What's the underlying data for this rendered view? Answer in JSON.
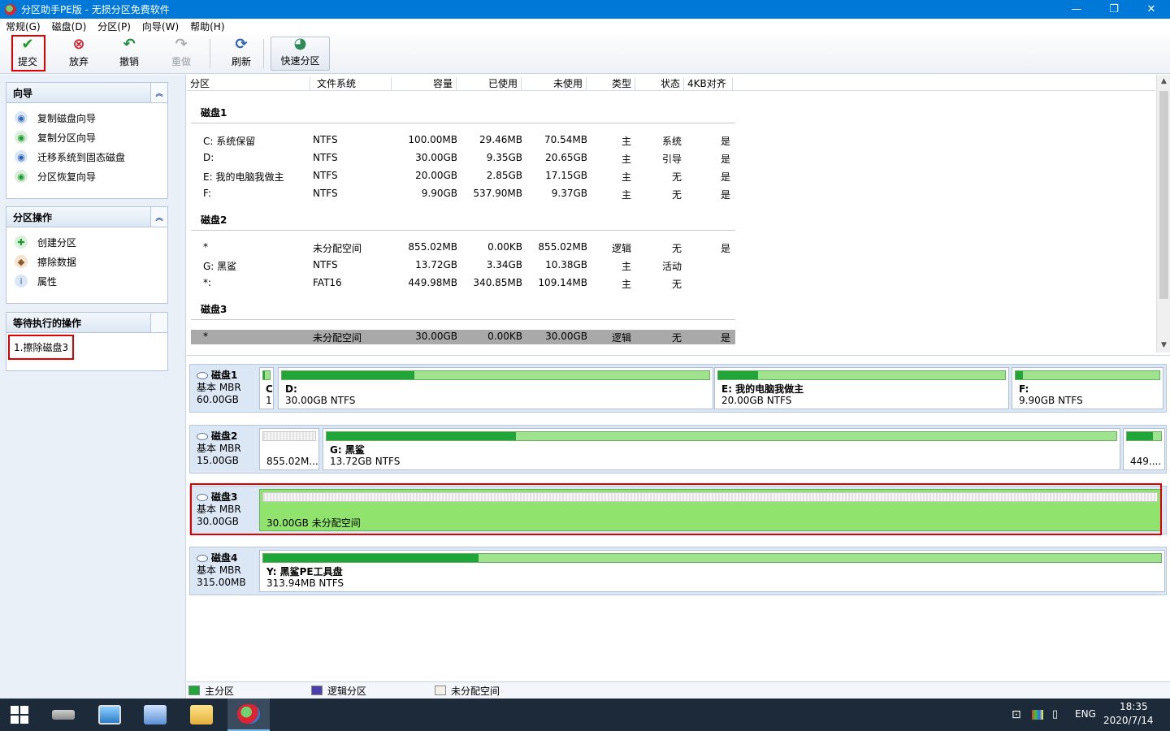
{
  "window": {
    "title": "分区助手PE版 - 无损分区免费软件",
    "minimize": "—",
    "maximize": "❐",
    "close": "✕"
  },
  "menu": [
    {
      "label": "常规(G)"
    },
    {
      "label": "磁盘(D)"
    },
    {
      "label": "分区(P)"
    },
    {
      "label": "向导(W)"
    },
    {
      "label": "帮助(H)"
    }
  ],
  "toolbar": {
    "submit": "提交",
    "discard": "放弃",
    "undo": "撤销",
    "redo": "重做",
    "refresh": "刷新",
    "quick_partition": "快速分区"
  },
  "sidebar": {
    "wizard": {
      "title": "向导",
      "items": [
        {
          "label": "复制磁盘向导"
        },
        {
          "label": "复制分区向导"
        },
        {
          "label": "迁移系统到固态磁盘"
        },
        {
          "label": "分区恢复向导"
        }
      ]
    },
    "partition_ops": {
      "title": "分区操作",
      "items": [
        {
          "label": "创建分区"
        },
        {
          "label": "擦除数据"
        },
        {
          "label": "属性"
        }
      ]
    },
    "pending": {
      "title": "等待执行的操作",
      "items": [
        {
          "label": "1.擦除磁盘3"
        }
      ]
    }
  },
  "table": {
    "headers": [
      "分区",
      "文件系统",
      "容量",
      "已使用",
      "未使用",
      "类型",
      "状态",
      "4KB对齐"
    ],
    "disks": [
      {
        "name": "磁盘1",
        "rows": [
          [
            "C: 系统保留",
            "NTFS",
            "100.00MB",
            "29.46MB",
            "70.54MB",
            "主",
            "系统",
            "是"
          ],
          [
            "D:",
            "NTFS",
            "30.00GB",
            "9.35GB",
            "20.65GB",
            "主",
            "引导",
            "是"
          ],
          [
            "E: 我的电脑我做主",
            "NTFS",
            "20.00GB",
            "2.85GB",
            "17.15GB",
            "主",
            "无",
            "是"
          ],
          [
            "F:",
            "NTFS",
            "9.90GB",
            "537.90MB",
            "9.37GB",
            "主",
            "无",
            "是"
          ]
        ]
      },
      {
        "name": "磁盘2",
        "rows": [
          [
            "*",
            "未分配空间",
            "855.02MB",
            "0.00KB",
            "855.02MB",
            "逻辑",
            "无",
            "是"
          ],
          [
            "G: 黑鲨",
            "NTFS",
            "13.72GB",
            "3.34GB",
            "10.38GB",
            "主",
            "活动",
            ""
          ],
          [
            "*:",
            "FAT16",
            "449.98MB",
            "340.85MB",
            "109.14MB",
            "主",
            "无",
            ""
          ]
        ]
      },
      {
        "name": "磁盘3",
        "rows": [
          [
            "*",
            "未分配空间",
            "30.00GB",
            "0.00KB",
            "30.00GB",
            "逻辑",
            "无",
            "是"
          ]
        ]
      }
    ]
  },
  "diskmap": [
    {
      "name": "磁盘1",
      "type": "基本 MBR",
      "size": "60.00GB",
      "partitions": [
        {
          "label": "C",
          "detail": "1",
          "used_fraction": 0.29
        },
        {
          "label": "D:",
          "detail": "30.00GB NTFS",
          "used_fraction": 0.31
        },
        {
          "label": "E: 我的电脑我做主",
          "detail": "20.00GB NTFS",
          "used_fraction": 0.14
        },
        {
          "label": "F:",
          "detail": "9.90GB NTFS",
          "used_fraction": 0.05
        }
      ]
    },
    {
      "name": "磁盘2",
      "type": "基本 MBR",
      "size": "15.00GB",
      "partitions": [
        {
          "label": "",
          "detail": "855.02M...",
          "used_fraction": 0
        },
        {
          "label": "G: 黑鲨",
          "detail": "13.72GB NTFS",
          "used_fraction": 0.24
        },
        {
          "label": "",
          "detail": "449....",
          "used_fraction": 0.76
        }
      ]
    },
    {
      "name": "磁盘3",
      "type": "基本 MBR",
      "size": "30.00GB",
      "partitions": [
        {
          "label": "",
          "detail": "30.00GB 未分配空间",
          "used_fraction": 0
        }
      ]
    },
    {
      "name": "磁盘4",
      "type": "基本 MBR",
      "size": "315.00MB",
      "partitions": [
        {
          "label": "Y: 黑鲨PE工具盘",
          "detail": "313.94MB NTFS",
          "used_fraction": 0.24
        }
      ]
    }
  ],
  "legend": {
    "primary": "主分区",
    "logical": "逻辑分区",
    "unallocated": "未分配空间"
  },
  "colors": {
    "titlebar": "#0078d7",
    "used": "#20a538",
    "free": "#9fe38f",
    "logical": "#4b3fae",
    "highlight": "#e00000"
  },
  "taskbar": {
    "lang": "ENG",
    "time": "18:35",
    "date": "2020/7/14"
  }
}
